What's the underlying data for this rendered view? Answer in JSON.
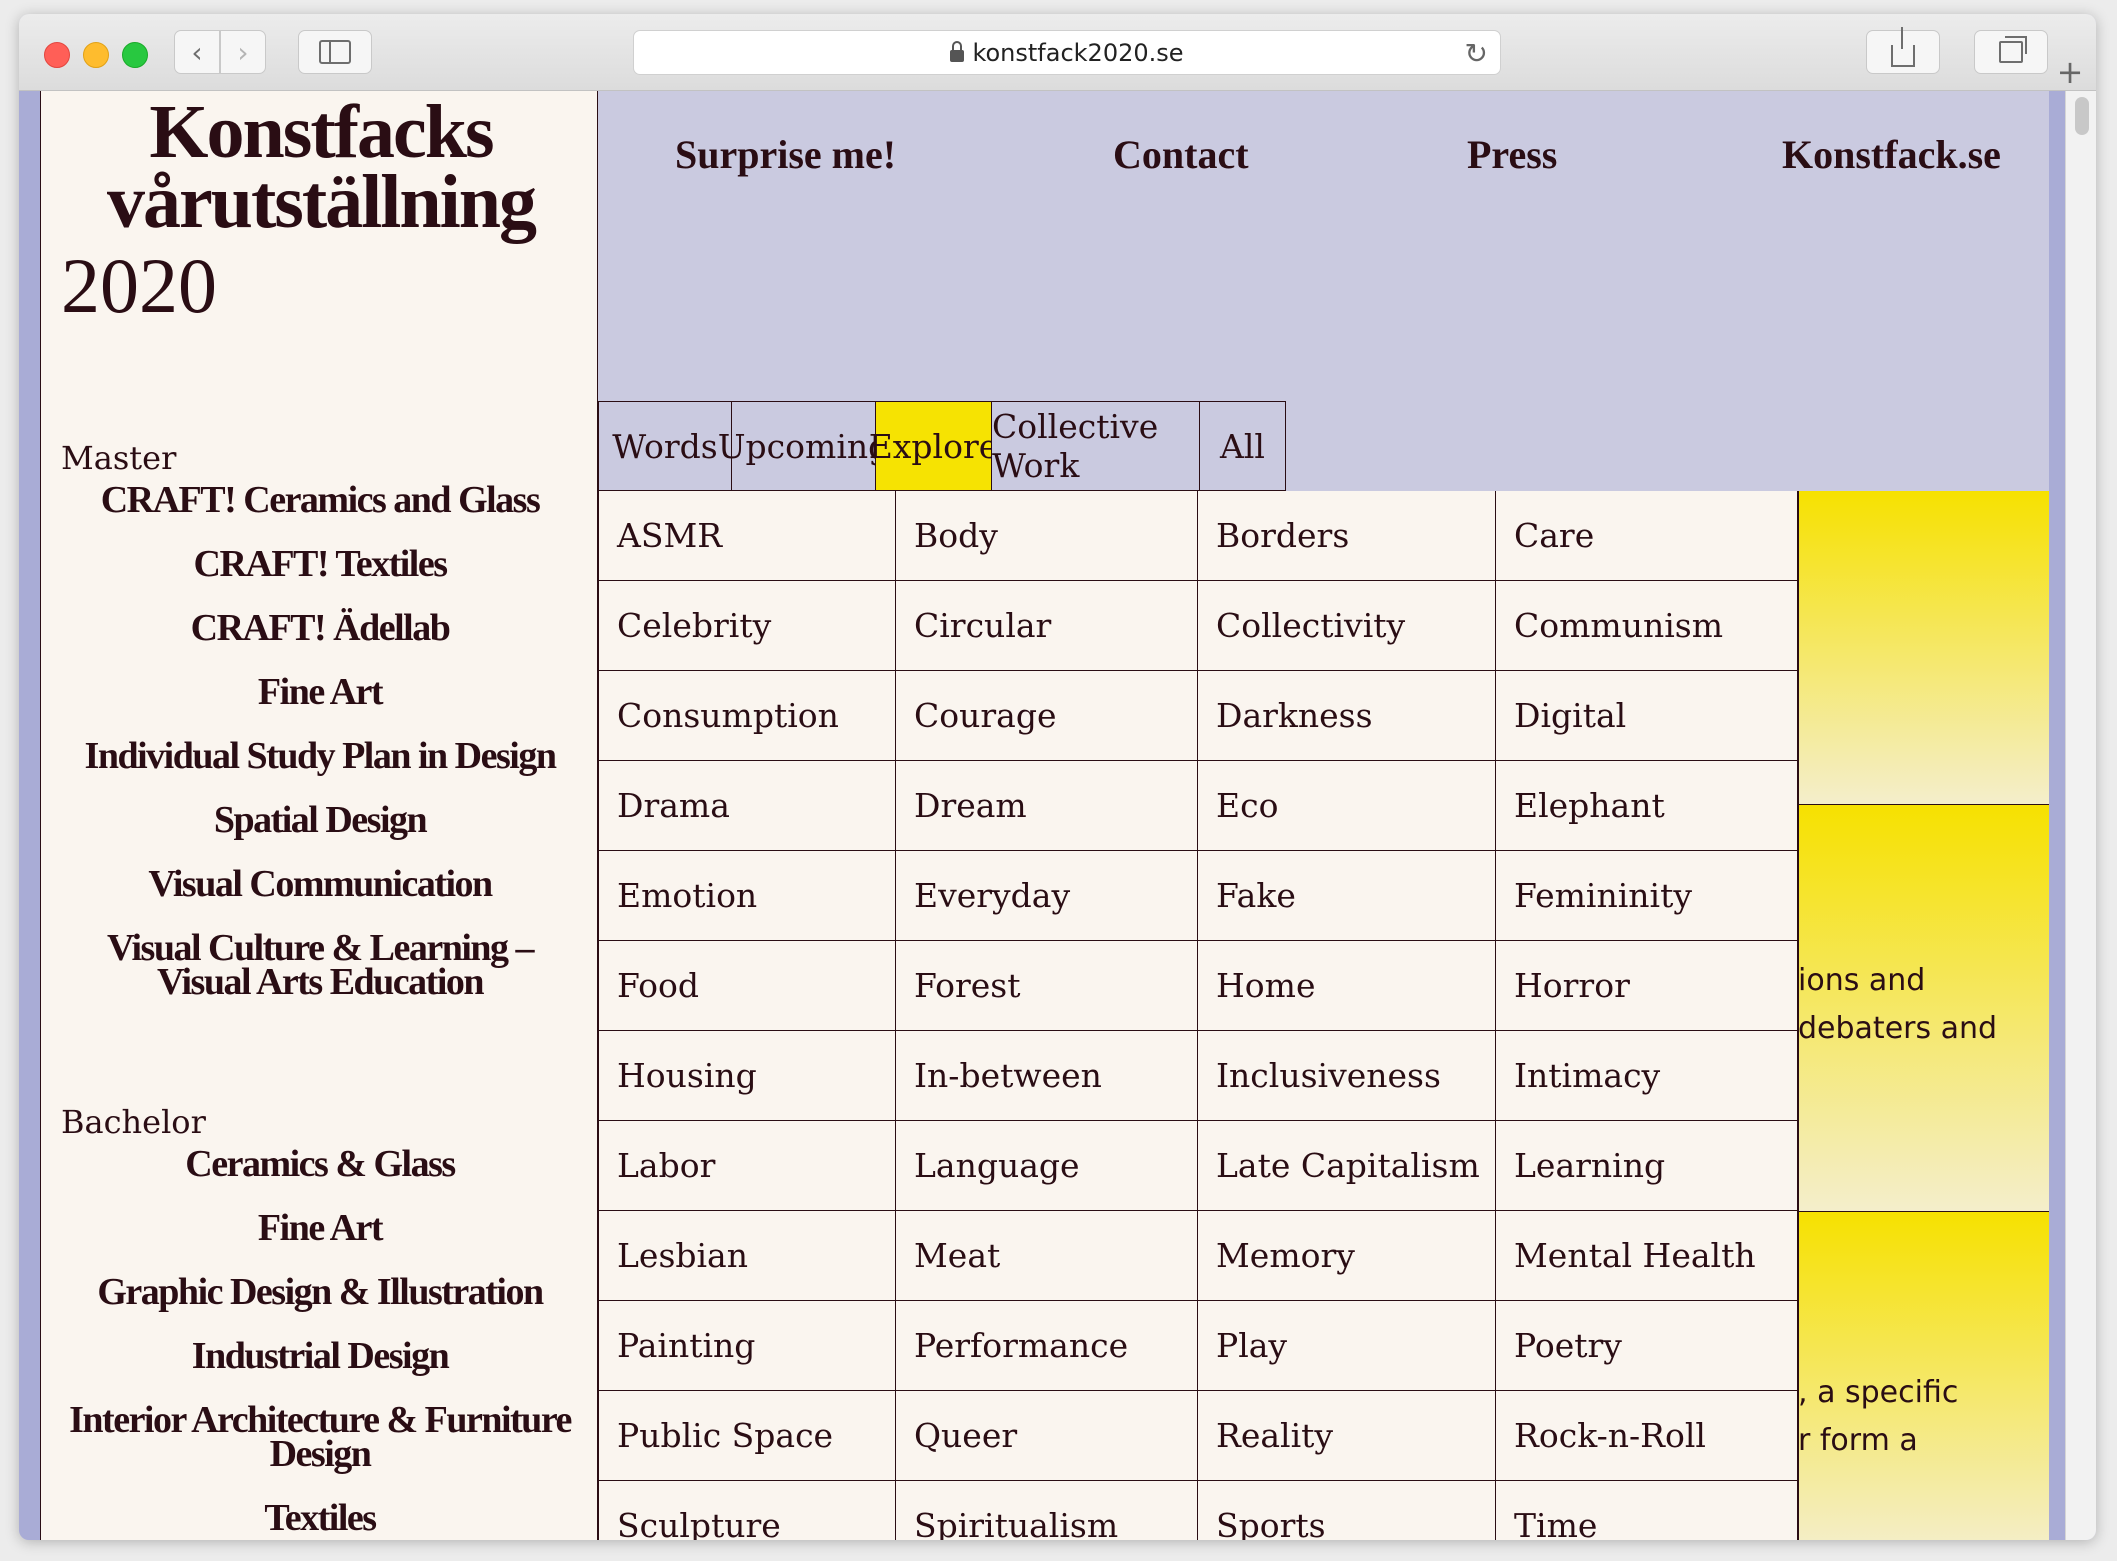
{
  "browser": {
    "url": "konstfack2020.se"
  },
  "site": {
    "title_line1": "Konstfacks",
    "title_line2": "vårutställning",
    "year": "2020"
  },
  "sidebar": {
    "master_label": "Master",
    "master_programs": [
      "CRAFT! Ceramics and Glass",
      "CRAFT! Textiles",
      "CRAFT! Ädellab",
      "Fine Art",
      "Individual Study Plan in Design",
      "Spatial Design",
      "Visual Communication",
      "Visual Culture & Learning –\nVisual Arts Education"
    ],
    "bachelor_label": "Bachelor",
    "bachelor_programs": [
      "Ceramics & Glass",
      "Fine Art",
      "Graphic Design & Illustration",
      "Industrial Design",
      "Interior Architecture & Furniture\nDesign",
      "Textiles"
    ]
  },
  "topnav": {
    "surprise": "Surprise me!",
    "contact": "Contact",
    "press": "Press",
    "konstfack": "Konstfack.se"
  },
  "tabs": [
    {
      "label": "Words",
      "active": false
    },
    {
      "label": "Upcoming",
      "active": false
    },
    {
      "label": "Explore",
      "active": true
    },
    {
      "label": "Collective Work",
      "active": false
    },
    {
      "label": "All",
      "active": false
    }
  ],
  "words": [
    [
      "ASMR",
      "Body",
      "Borders",
      "Care"
    ],
    [
      "Celebrity",
      "Circular",
      "Collectivity",
      "Communism"
    ],
    [
      "Consumption",
      "Courage",
      "Darkness",
      "Digital"
    ],
    [
      "Drama",
      "Dream",
      "Eco",
      "Elephant"
    ],
    [
      "Emotion",
      "Everyday",
      "Fake",
      "Femininity"
    ],
    [
      "Food",
      "Forest",
      "Home",
      "Horror"
    ],
    [
      "Housing",
      "In-between",
      "Inclusiveness",
      "Intimacy"
    ],
    [
      "Labor",
      "Language",
      "Late Capitalism",
      "Learning"
    ],
    [
      "Lesbian",
      "Meat",
      "Memory",
      "Mental Health"
    ],
    [
      "Painting",
      "Performance",
      "Play",
      "Poetry"
    ],
    [
      "Public Space",
      "Queer",
      "Reality",
      "Rock-n-Roll"
    ],
    [
      "Sculpture",
      "Spiritualism",
      "Sports",
      "Time"
    ]
  ],
  "background_text": {
    "line1": "ions and",
    "line2": "debaters and",
    "line3": ", a specific",
    "line4": "r form a"
  },
  "colors": {
    "ink": "#2a0d14",
    "lavender": "#cacae0",
    "cream": "#faf5ef",
    "yellow": "#f6e302"
  }
}
